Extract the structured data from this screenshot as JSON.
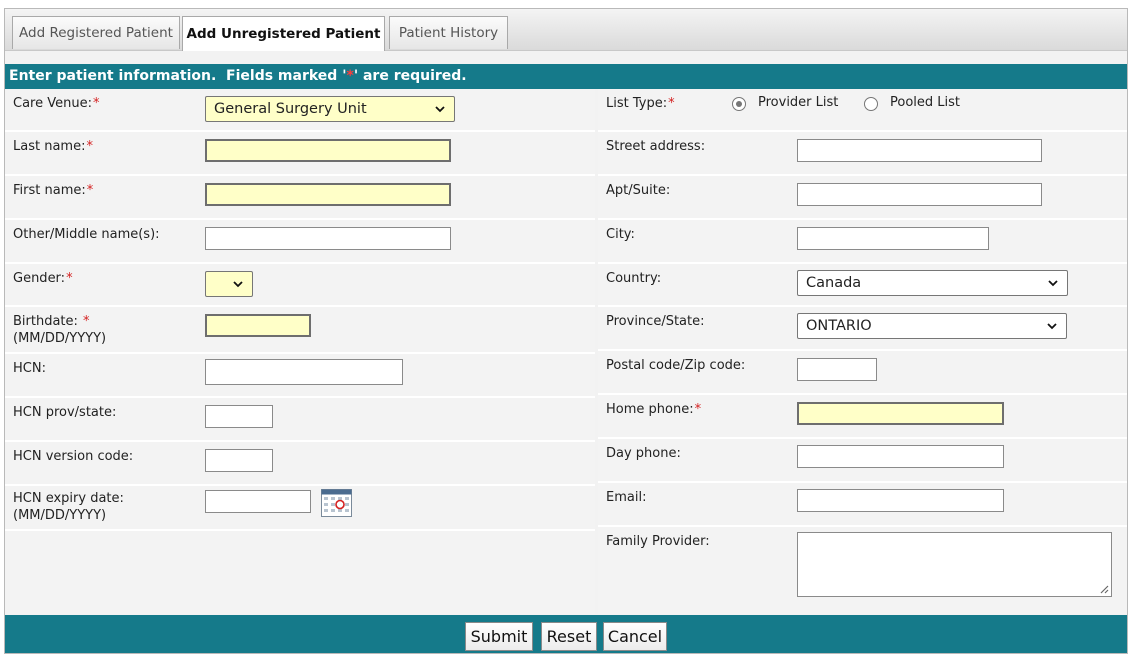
{
  "tabs": [
    {
      "label": "Add Registered Patient"
    },
    {
      "label": "Add Unregistered Patient"
    },
    {
      "label": "Patient History"
    }
  ],
  "section": {
    "header_pre": "Enter patient information.  Fields marked '",
    "header_star": "*",
    "header_post": "' are required."
  },
  "left": {
    "care_venue": {
      "label": "Care Venue:",
      "value": "General Surgery Unit"
    },
    "last_name": {
      "label": "Last name:",
      "value": ""
    },
    "first_name": {
      "label": "First name:",
      "value": ""
    },
    "other_name": {
      "label": "Other/Middle name(s):",
      "value": ""
    },
    "gender": {
      "label": "Gender:",
      "value": ""
    },
    "birthdate": {
      "label": "Birthdate: ",
      "format": "(MM/DD/YYYY)",
      "value": ""
    },
    "hcn": {
      "label": "HCN:",
      "value": ""
    },
    "hcn_prov": {
      "label": "HCN prov/state:",
      "value": ""
    },
    "hcn_version": {
      "label": "HCN version code:",
      "value": ""
    },
    "hcn_expiry": {
      "label": "HCN expiry date:",
      "format": "(MM/DD/YYYY)",
      "value": ""
    }
  },
  "right": {
    "list_type": {
      "label": "List Type:",
      "option1": "Provider List",
      "option2": "Pooled List",
      "selected": "Provider List"
    },
    "street": {
      "label": "Street address:",
      "value": ""
    },
    "apt": {
      "label": "Apt/Suite:",
      "value": ""
    },
    "city": {
      "label": "City:",
      "value": ""
    },
    "country": {
      "label": "Country:",
      "value": "Canada"
    },
    "province": {
      "label": "Province/State:",
      "value": "ONTARIO"
    },
    "postal": {
      "label": "Postal code/Zip code:",
      "value": ""
    },
    "home_phone": {
      "label": "Home phone:",
      "value": ""
    },
    "day_phone": {
      "label": "Day phone:",
      "value": ""
    },
    "email": {
      "label": "Email:",
      "value": ""
    },
    "family_provider": {
      "label": "Family Provider:",
      "value": ""
    }
  },
  "required_star": "*",
  "buttons": {
    "submit": "Submit",
    "reset": "Reset",
    "cancel": "Cancel"
  },
  "colors": {
    "accent": "#157a8a",
    "required_field": "#ffffc8",
    "required_star": "#d42020"
  },
  "icons": {
    "calendar": "calendar-icon",
    "dropdown": "chevron-down-icon",
    "resize": "resize-grip-icon"
  }
}
